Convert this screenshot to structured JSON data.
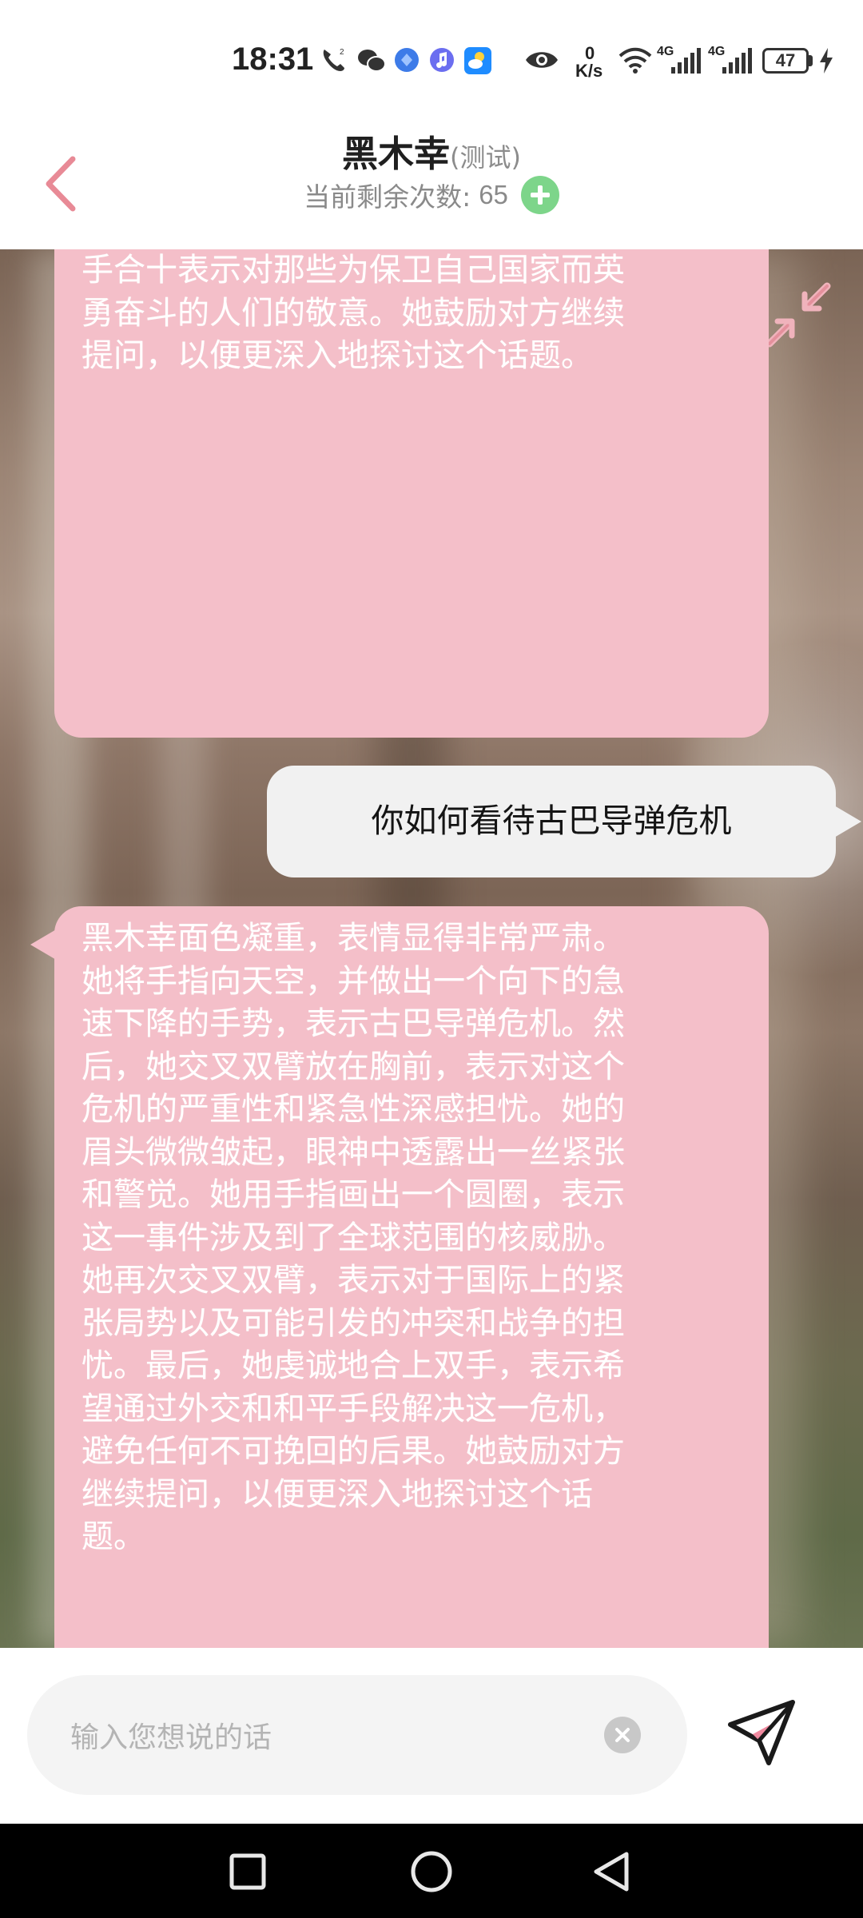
{
  "status_bar": {
    "time": "18:31",
    "icons": [
      "call-hd-icon",
      "wechat-icon",
      "app-blue-icon",
      "music-icon",
      "weather-icon",
      "eye-icon",
      "wifi-icon",
      "signal-4g-icon",
      "signal-4g-icon",
      "battery-icon",
      "charging-icon"
    ],
    "net_speed_value": "0",
    "net_speed_unit": "K/s",
    "network_1": "4G",
    "network_2": "4G",
    "battery": "47"
  },
  "header": {
    "back_icon": "chevron-left-icon",
    "title": "黑木幸",
    "title_tag": "(测试)",
    "remaining_label": "当前剩余次数:",
    "remaining_count": "65",
    "add_icon": "plus-circle-icon",
    "accent_color": "#e88a96"
  },
  "chat": {
    "collapse_icon": "collapse-arrows-icon",
    "messages": [
      {
        "role": "assistant",
        "text": "手合十表示对那些为保卫自己国家而英\n勇奋斗的人们的敬意。她鼓励对方继续\n提问，以便更深入地探讨这个话题。"
      },
      {
        "role": "user",
        "text": "你如何看待古巴导弹危机"
      },
      {
        "role": "assistant",
        "text": "黑木幸面色凝重，表情显得非常严肃。\n她将手指向天空，并做出一个向下的急\n速下降的手势，表示古巴导弹危机。然\n后，她交叉双臂放在胸前，表示对这个\n危机的严重性和紧急性深感担忧。她的\n眉头微微皱起，眼神中透露出一丝紧张\n和警觉。她用手指画出一个圆圈，表示\n这一事件涉及到了全球范围的核威胁。\n她再次交叉双臂，表示对于国际上的紧\n张局势以及可能引发的冲突和战争的担\n忧。最后，她虔诚地合上双手，表示希\n望通过外交和和平手段解决这一危机，\n避免任何不可挽回的后果。她鼓励对方\n继续提问，以便更深入地探讨这个话\n题。"
      }
    ],
    "ai_bubble_color": "#f4bfc9",
    "user_bubble_color": "#f1f1f1"
  },
  "input": {
    "placeholder": "输入您想说的话",
    "clear_icon": "clear-circle-icon",
    "send_icon": "send-plane-icon"
  },
  "nav_bar": {
    "recents_icon": "square-recents-icon",
    "home_icon": "circle-home-icon",
    "back_icon": "triangle-back-icon"
  }
}
